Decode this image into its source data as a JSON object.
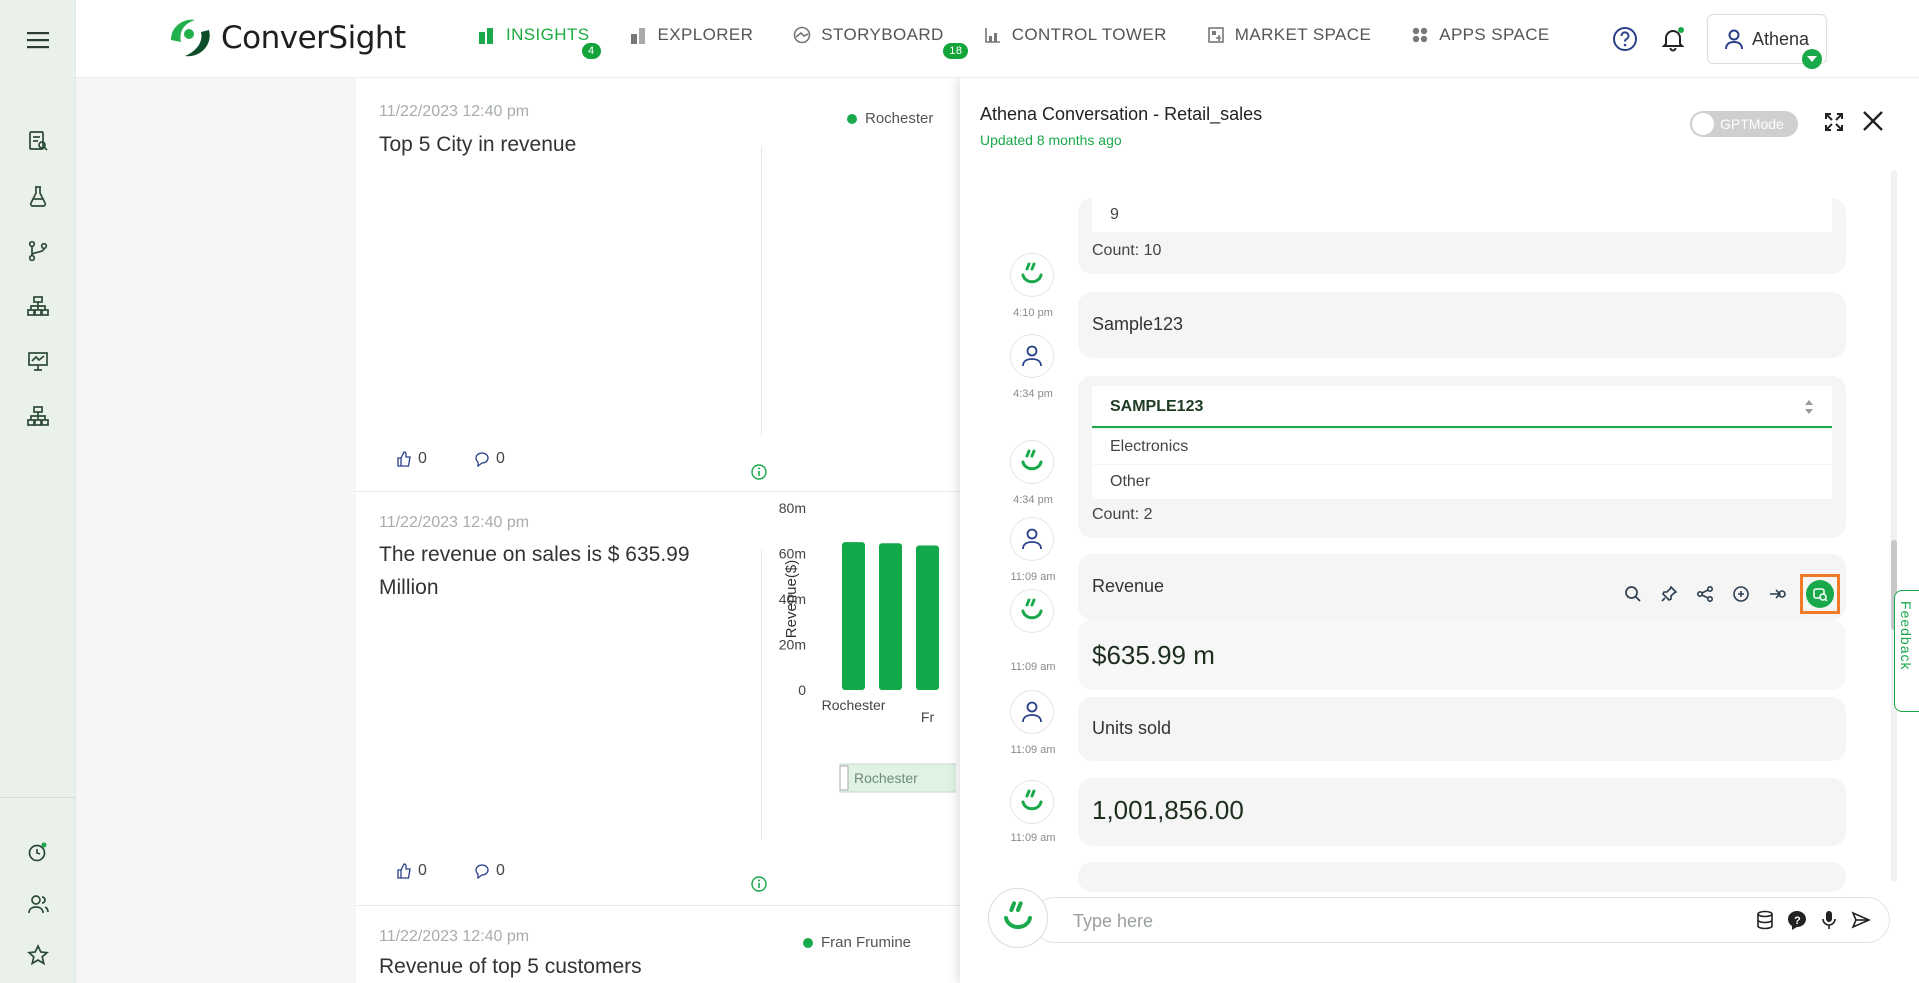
{
  "brand": {
    "name": "ConverSight",
    "color": "#1aa94a"
  },
  "nav": {
    "items": [
      {
        "label": "INSIGHTS",
        "icon": "bar-chart-icon",
        "badge": "4"
      },
      {
        "label": "EXPLORER",
        "icon": "explorer-icon",
        "badge": ""
      },
      {
        "label": "STORYBOARD",
        "icon": "storyboard-icon",
        "badge": "18"
      },
      {
        "label": "CONTROL TOWER",
        "icon": "control-tower-icon",
        "badge": ""
      },
      {
        "label": "MARKET SPACE",
        "icon": "market-space-icon",
        "badge": ""
      },
      {
        "label": "APPS SPACE",
        "icon": "apps-space-icon",
        "badge": ""
      }
    ],
    "user": "Athena"
  },
  "insights": {
    "cards": [
      {
        "date": "11/22/2023 12:40 pm",
        "title": "Top 5 City in revenue",
        "legend": "Rochester",
        "likes": "0",
        "comments": "0"
      },
      {
        "date": "11/22/2023 12:40 pm",
        "title": "The revenue on sales is $ 635.99 Million",
        "likes": "0",
        "comments": "0"
      },
      {
        "date": "11/22/2023 12:40 pm",
        "title": "Revenue of top 5 customers",
        "legend": "Fran Frumine"
      }
    ]
  },
  "chart_data": {
    "type": "bar",
    "ylabel": "Revenue($)",
    "yticks": [
      "0",
      "20m",
      "40m",
      "60m",
      "80m"
    ],
    "ylim": [
      0,
      80
    ],
    "categories": [
      "Rochester",
      "",
      "Fr"
    ],
    "values": [
      65,
      64.5,
      63.5
    ],
    "slider_label": "Rochester"
  },
  "conversation": {
    "title": "Athena Conversation - Retail_sales",
    "updated": "Updated 8 months ago",
    "gpt_mode": "GPTMode",
    "messages": {
      "m1_value": "9",
      "m1_count": "Count: 10",
      "m1_time": "4:10 pm",
      "m2_text": "Sample123",
      "m2_time": "4:34 pm",
      "m3_header": "SAMPLE123",
      "m3_rows": [
        "Electronics",
        "Other"
      ],
      "m3_count": "Count: 2",
      "m3_time": "4:34 pm",
      "m4_text": "Revenue",
      "m4_time": "11:09 am",
      "m5_value": "$635.99 m",
      "m5_time": "11:09 am",
      "m6_text": "Units sold",
      "m6_time": "11:09 am",
      "m7_value": "1,001,856.00",
      "m7_time": "11:09 am"
    },
    "composer_placeholder": "Type here"
  },
  "feedback": "Feedback"
}
